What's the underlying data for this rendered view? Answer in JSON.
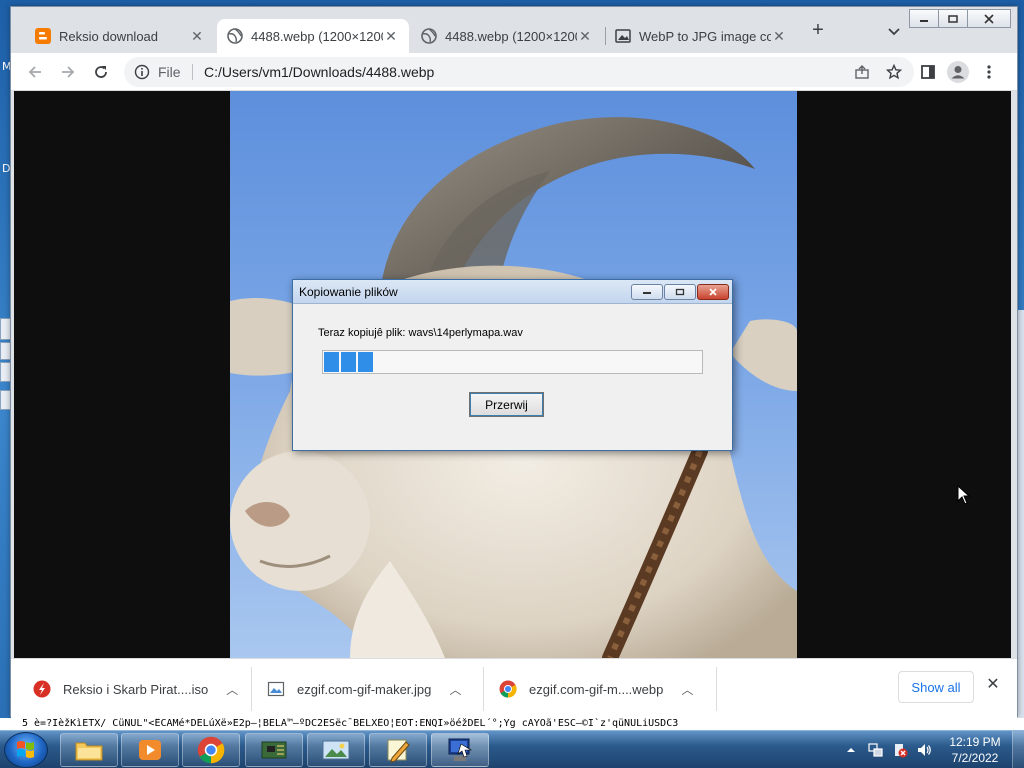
{
  "desktop": {
    "edge_letters": [
      "M",
      "D"
    ]
  },
  "browser": {
    "tabs": [
      {
        "title": "Reksio download",
        "active": false
      },
      {
        "title": "4488.webp (1200×1200)",
        "active": true
      },
      {
        "title": "4488.webp (1200×1200)",
        "active": false
      },
      {
        "title": "WebP to JPG image con",
        "active": false
      }
    ],
    "new_tab": "+",
    "omnibox": {
      "scheme_label": "File",
      "url": "C:/Users/vm1/Downloads/4488.webp"
    }
  },
  "dialog": {
    "title": "Kopiowanie plików",
    "status": "Teraz kopiujê plik: wavs\\14perlymapa.wav",
    "progress_blocks": 3,
    "cancel_label": "Przerwij"
  },
  "downloads": {
    "items": [
      {
        "name": "Reksio i Skarb Pirat....iso",
        "icon": "flash-icon"
      },
      {
        "name": "ezgif.com-gif-maker.jpg",
        "icon": "image-file-icon"
      },
      {
        "name": "ezgif.com-gif-m....webp",
        "icon": "chrome-icon"
      }
    ],
    "show_all": "Show all"
  },
  "garbage": "5   è=?ÏèžKìETX/ CüNUL\"<ÊCAMé*DELúXë»Ë2p–¦BELÃ™–ºDC2ESëc¯BELXÊO¦EOT:ENQI»öéžDEL´°;Yg cAYOã'ESC–©I`z'qüNULiUSDC3",
  "taskbar": {
    "time": "12:19 PM",
    "date": "7/2/2022"
  },
  "colors": {
    "accent": "#1a73e8",
    "progress": "#2f8fe8",
    "sky": "#7aa6e6"
  }
}
